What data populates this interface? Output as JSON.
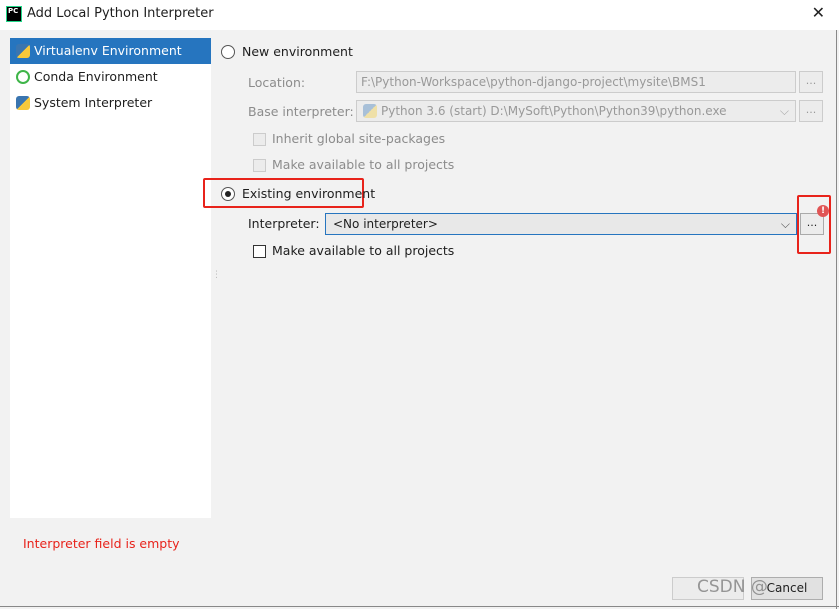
{
  "window": {
    "title": "Add Local Python Interpreter",
    "close": "✕",
    "logo": "PC"
  },
  "sidebar": {
    "items": [
      {
        "label": "Virtualenv Environment",
        "icon": "virtualenv-icon",
        "selected": true
      },
      {
        "label": "Conda Environment",
        "icon": "conda-icon"
      },
      {
        "label": "System Interpreter",
        "icon": "python-icon"
      }
    ]
  },
  "new_env": {
    "label": "New environment",
    "selected": false,
    "location_label": "Location:",
    "location_value": "F:\\Python-Workspace\\python-django-project\\mysite\\BMS1",
    "base_label": "Base interpreter:",
    "base_value": "Python 3.6 (start) D:\\MySoft\\Python\\Python39\\python.exe",
    "inherit_label": "Inherit global site-packages",
    "make_available_label": "Make available to all projects",
    "browse": "..."
  },
  "existing_env": {
    "label": "Existing environment",
    "selected": true,
    "interpreter_label": "Interpreter:",
    "interpreter_value": "<No interpreter>",
    "browse": "...",
    "make_available_label": "Make available to all projects",
    "make_available_checked": false
  },
  "error": "Interpreter field is empty",
  "buttons": {
    "ok": "",
    "cancel": "Cancel"
  },
  "watermark": "CSDN @"
}
